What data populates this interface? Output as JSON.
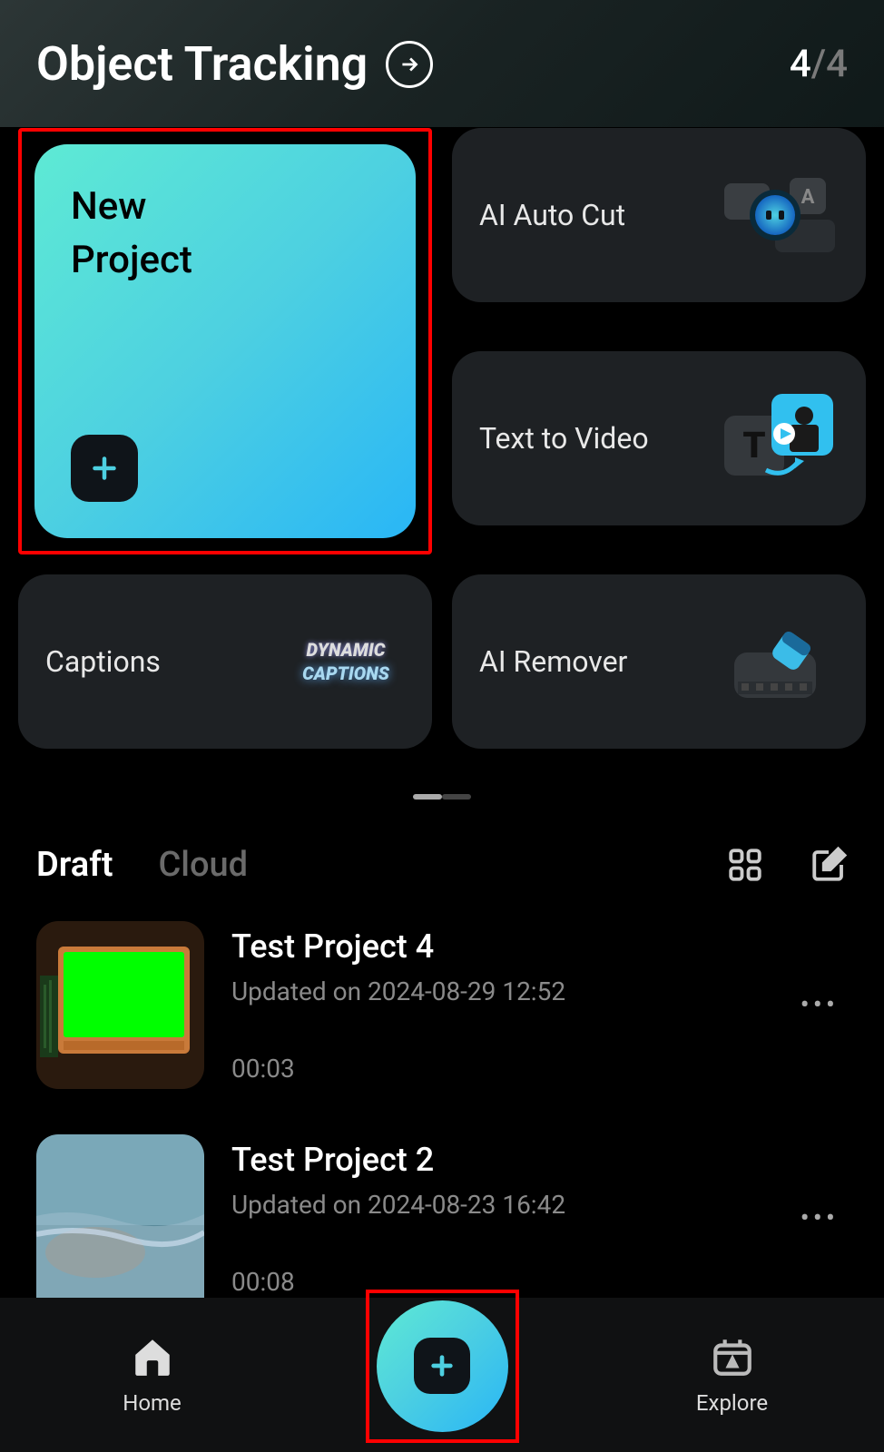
{
  "header": {
    "title": "Object Tracking",
    "counter_current": "4",
    "counter_sep": "/",
    "counter_total": "4"
  },
  "tiles": {
    "new_project": "New\nProject",
    "ai_auto_cut": "AI Auto Cut",
    "text_to_video": "Text to Video",
    "captions": "Captions",
    "captions_badge_l1": "DYNAMIC",
    "captions_badge_l2": "CAPTIONS",
    "ai_remover": "AI Remover"
  },
  "drafts": {
    "tabs": {
      "draft": "Draft",
      "cloud": "Cloud"
    },
    "items": [
      {
        "name": "Test Project 4",
        "updated": "Updated on 2024-08-29 12:52",
        "duration": "00:03"
      },
      {
        "name": "Test Project 2",
        "updated": "Updated on 2024-08-23 16:42",
        "duration": "00:08"
      }
    ]
  },
  "nav": {
    "home": "Home",
    "explore": "Explore"
  }
}
